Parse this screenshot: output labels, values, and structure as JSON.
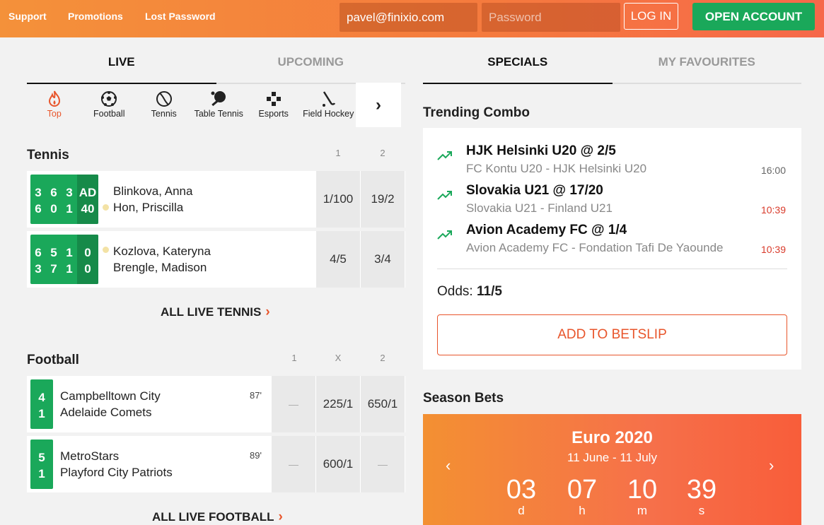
{
  "header": {
    "links": [
      "Support",
      "Promotions",
      "Lost Password"
    ],
    "email_value": "pavel@finixio.com",
    "password_placeholder": "Password",
    "login_label": "LOG IN",
    "open_account_label": "OPEN ACCOUNT"
  },
  "left_tabs": [
    "LIVE",
    "UPCOMING"
  ],
  "right_tabs": [
    "SPECIALS",
    "MY FAVOURITES"
  ],
  "sports": [
    {
      "label": "Top",
      "icon": "flame-icon"
    },
    {
      "label": "Football",
      "icon": "football-icon"
    },
    {
      "label": "Tennis",
      "icon": "tennis-ball-icon"
    },
    {
      "label": "Table Tennis",
      "icon": "table-tennis-icon"
    },
    {
      "label": "Esports",
      "icon": "gamepad-icon"
    },
    {
      "label": "Field Hockey",
      "icon": "hockey-stick-icon"
    }
  ],
  "sports_next_icon": "chevron-right-icon",
  "tennis": {
    "title": "Tennis",
    "col_headers": [
      "1",
      "2"
    ],
    "matches": [
      {
        "p1": "Blinkova, Anna",
        "p2": "Hon, Priscilla",
        "s1": [
          "3",
          "6",
          "3",
          "AD"
        ],
        "s2": [
          "6",
          "0",
          "1",
          "40"
        ],
        "odd1": "1/100",
        "odd2": "19/2"
      },
      {
        "p1": "Kozlova, Kateryna",
        "p2": "Brengle, Madison",
        "s1": [
          "6",
          "5",
          "1",
          "0"
        ],
        "s2": [
          "3",
          "7",
          "1",
          "0"
        ],
        "odd1": "4/5",
        "odd2": "3/4"
      }
    ],
    "all_link": "ALL LIVE TENNIS"
  },
  "football": {
    "title": "Football",
    "col_headers": [
      "1",
      "X",
      "2"
    ],
    "matches": [
      {
        "home": "Campbelltown City",
        "away": "Adelaide Comets",
        "h": "4",
        "a": "1",
        "minute": "87'",
        "o1": "—",
        "ox": "225/1",
        "o2": "650/1"
      },
      {
        "home": "MetroStars",
        "away": "Playford City Patriots",
        "h": "5",
        "a": "1",
        "minute": "89'",
        "o1": "—",
        "ox": "600/1",
        "o2": "—"
      }
    ],
    "all_link": "ALL LIVE FOOTBALL"
  },
  "trending": {
    "title": "Trending Combo",
    "items": [
      {
        "title": "HJK Helsinki U20 @ 2/5",
        "sub": "FC Kontu U20 - HJK Helsinki U20",
        "time": "16:00"
      },
      {
        "title": "Slovakia U21 @ 17/20",
        "sub": "Slovakia U21 - Finland U21",
        "time": "10:39"
      },
      {
        "title": "Avion Academy FC @ 1/4",
        "sub": "Avion Academy FC - Fondation Tafi De Yaounde",
        "time": "10:39"
      }
    ],
    "odds_label": "Odds:",
    "odds_value": "11/5",
    "add_label": "ADD TO BETSLIP"
  },
  "season": {
    "title": "Season Bets",
    "event": "Euro 2020",
    "dates": "11 June - 11 July",
    "countdown": [
      {
        "n": "03",
        "u": "d"
      },
      {
        "n": "07",
        "u": "h"
      },
      {
        "n": "10",
        "u": "m"
      },
      {
        "n": "39",
        "u": "s"
      }
    ]
  },
  "colors": {
    "accent": "#e8552b",
    "green": "#1aa85a",
    "live_time": "#d93a2a"
  }
}
